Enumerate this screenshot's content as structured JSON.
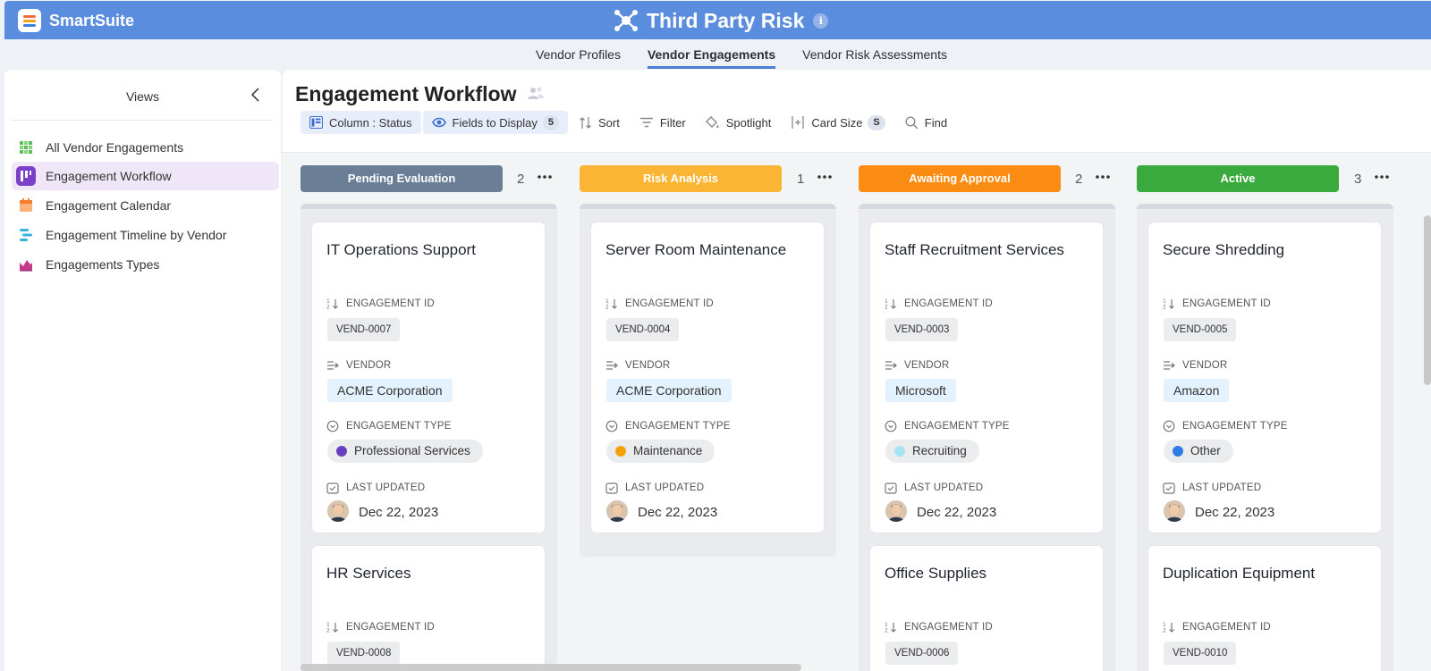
{
  "brand": {
    "name": "SmartSuite"
  },
  "app": {
    "title": "Third Party Risk",
    "info_icon": "info-icon"
  },
  "tabs": [
    {
      "label": "Vendor Profiles",
      "active": false
    },
    {
      "label": "Vendor Engagements",
      "active": true
    },
    {
      "label": "Vendor Risk Assessments",
      "active": false
    }
  ],
  "sidebar": {
    "title": "Views",
    "items": [
      {
        "label": "All Vendor Engagements",
        "icon": "grid-view-icon",
        "active": false
      },
      {
        "label": "Engagement Workflow",
        "icon": "kanban-view-icon",
        "active": true
      },
      {
        "label": "Engagement Calendar",
        "icon": "calendar-view-icon",
        "active": false
      },
      {
        "label": "Engagement Timeline by Vendor",
        "icon": "timeline-view-icon",
        "active": false
      },
      {
        "label": "Engagements Types",
        "icon": "chart-view-icon",
        "active": false
      }
    ]
  },
  "view": {
    "title": "Engagement Workflow",
    "toolbar": {
      "column_label": "Column :",
      "column_value": "Status",
      "fields_label": "Fields to Display",
      "fields_count": "5",
      "sort": "Sort",
      "filter": "Filter",
      "spotlight": "Spotlight",
      "card_size": "Card Size",
      "card_size_value": "S",
      "find": "Find"
    }
  },
  "field_labels": {
    "id": "ENGAGEMENT ID",
    "vendor": "VENDOR",
    "type": "ENGAGEMENT TYPE",
    "updated": "LAST UPDATED"
  },
  "columns": [
    {
      "name": "Pending Evaluation",
      "count": "2",
      "color": "#6a7f96",
      "cards": [
        {
          "title": "IT Operations Support",
          "id": "VEND-0007",
          "vendor": "ACME Corporation",
          "type": "Professional Services",
          "type_color": "#6a3fbf",
          "updated": "Dec 22, 2023"
        },
        {
          "title": "HR Services",
          "id": "VEND-0008"
        }
      ]
    },
    {
      "name": "Risk Analysis",
      "count": "1",
      "color": "#fbb534",
      "cards": [
        {
          "title": "Server Room Maintenance",
          "id": "VEND-0004",
          "vendor": "ACME Corporation",
          "type": "Maintenance",
          "type_color": "#f5a20a",
          "updated": "Dec 22, 2023"
        }
      ]
    },
    {
      "name": "Awaiting Approval",
      "count": "2",
      "color": "#fb8c13",
      "cards": [
        {
          "title": "Staff Recruitment Services",
          "id": "VEND-0003",
          "vendor": "Microsoft",
          "type": "Recruiting",
          "type_color": "#a8e4f5",
          "updated": "Dec 22, 2023"
        },
        {
          "title": "Office Supplies",
          "id": "VEND-0006"
        }
      ]
    },
    {
      "name": "Active",
      "count": "3",
      "color": "#3aaa3e",
      "cards": [
        {
          "title": "Secure Shredding",
          "id": "VEND-0005",
          "vendor": "Amazon",
          "type": "Other",
          "type_color": "#2f7be5",
          "updated": "Dec 22, 2023"
        },
        {
          "title": "Duplication Equipment",
          "id": "VEND-0010"
        }
      ]
    }
  ]
}
